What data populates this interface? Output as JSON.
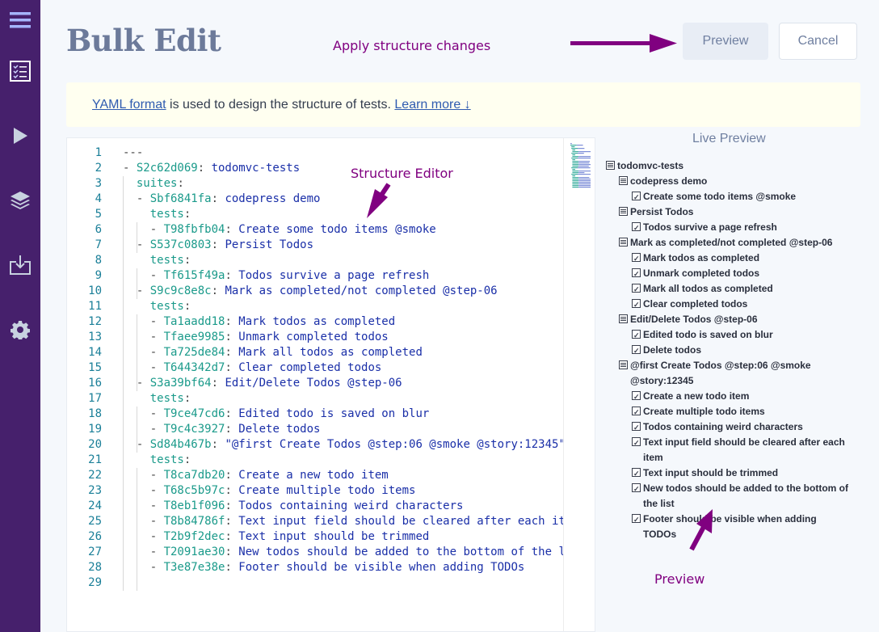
{
  "sidebar": {
    "items": [
      {
        "icon": "hamburger-menu-icon"
      },
      {
        "icon": "checklist-icon"
      },
      {
        "icon": "play-icon"
      },
      {
        "icon": "layers-icon"
      },
      {
        "icon": "download-icon"
      },
      {
        "icon": "gear-icon"
      }
    ]
  },
  "header": {
    "title": "Bulk Edit",
    "preview_label": "Preview",
    "cancel_label": "Cancel"
  },
  "annotations": {
    "apply": "Apply structure changes",
    "editor": "Structure Editor",
    "preview": "Preview",
    "color": "#800080"
  },
  "notice": {
    "link1": "YAML format",
    "text": " is used to design the structure of tests. ",
    "link2": "Learn more ↓"
  },
  "editor": {
    "lines": [
      {
        "n": "1",
        "indent": "",
        "dash": "",
        "key": "",
        "sep": "",
        "val": "---",
        "plain": true
      },
      {
        "n": "2",
        "indent": "",
        "dash": "- ",
        "key": "S2c62d069",
        "sep": ": ",
        "val": "todomvc-tests"
      },
      {
        "n": "3",
        "indent": "  ",
        "dash": "",
        "key": "suites",
        "sep": ":",
        "val": ""
      },
      {
        "n": "4",
        "indent": "  ",
        "dash": "- ",
        "key": "Sbf6841fa",
        "sep": ": ",
        "val": "codepress demo"
      },
      {
        "n": "5",
        "indent": "    ",
        "dash": "",
        "key": "tests",
        "sep": ":",
        "val": ""
      },
      {
        "n": "6",
        "indent": "    ",
        "dash": "- ",
        "key": "T98fbfb04",
        "sep": ": ",
        "val": "Create some todo items @smoke"
      },
      {
        "n": "7",
        "indent": "  ",
        "dash": "- ",
        "key": "S537c0803",
        "sep": ": ",
        "val": "Persist Todos"
      },
      {
        "n": "8",
        "indent": "    ",
        "dash": "",
        "key": "tests",
        "sep": ":",
        "val": ""
      },
      {
        "n": "9",
        "indent": "    ",
        "dash": "- ",
        "key": "Tf615f49a",
        "sep": ": ",
        "val": "Todos survive a page refresh"
      },
      {
        "n": "10",
        "indent": "  ",
        "dash": "- ",
        "key": "S9c9c8e8c",
        "sep": ": ",
        "val": "Mark as completed/not completed @step-06"
      },
      {
        "n": "11",
        "indent": "    ",
        "dash": "",
        "key": "tests",
        "sep": ":",
        "val": ""
      },
      {
        "n": "12",
        "indent": "    ",
        "dash": "- ",
        "key": "Ta1aadd18",
        "sep": ": ",
        "val": "Mark todos as completed"
      },
      {
        "n": "13",
        "indent": "    ",
        "dash": "- ",
        "key": "Tfaee9985",
        "sep": ": ",
        "val": "Unmark completed todos"
      },
      {
        "n": "14",
        "indent": "    ",
        "dash": "- ",
        "key": "Ta725de84",
        "sep": ": ",
        "val": "Mark all todos as completed"
      },
      {
        "n": "15",
        "indent": "    ",
        "dash": "- ",
        "key": "T644342d7",
        "sep": ": ",
        "val": "Clear completed todos"
      },
      {
        "n": "16",
        "indent": "  ",
        "dash": "- ",
        "key": "S3a39bf64",
        "sep": ": ",
        "val": "Edit/Delete Todos @step-06"
      },
      {
        "n": "17",
        "indent": "    ",
        "dash": "",
        "key": "tests",
        "sep": ":",
        "val": ""
      },
      {
        "n": "18",
        "indent": "    ",
        "dash": "- ",
        "key": "T9ce47cd6",
        "sep": ": ",
        "val": "Edited todo is saved on blur"
      },
      {
        "n": "19",
        "indent": "    ",
        "dash": "- ",
        "key": "T9c4c3927",
        "sep": ": ",
        "val": "Delete todos"
      },
      {
        "n": "20",
        "indent": "  ",
        "dash": "- ",
        "key": "Sd84b467b",
        "sep": ": ",
        "val": "\"@first Create Todos @step:06 @smoke @story:12345\""
      },
      {
        "n": "21",
        "indent": "    ",
        "dash": "",
        "key": "tests",
        "sep": ":",
        "val": ""
      },
      {
        "n": "22",
        "indent": "    ",
        "dash": "- ",
        "key": "T8ca7db20",
        "sep": ": ",
        "val": "Create a new todo item"
      },
      {
        "n": "23",
        "indent": "    ",
        "dash": "- ",
        "key": "T68c5b97c",
        "sep": ": ",
        "val": "Create multiple todo items"
      },
      {
        "n": "24",
        "indent": "    ",
        "dash": "- ",
        "key": "T8eb1f096",
        "sep": ": ",
        "val": "Todos containing weird characters"
      },
      {
        "n": "25",
        "indent": "    ",
        "dash": "- ",
        "key": "T8b84786f",
        "sep": ": ",
        "val": "Text input field should be cleared after each it"
      },
      {
        "n": "26",
        "indent": "    ",
        "dash": "- ",
        "key": "T2b9f2dec",
        "sep": ": ",
        "val": "Text input should be trimmed"
      },
      {
        "n": "27",
        "indent": "    ",
        "dash": "- ",
        "key": "T2091ae30",
        "sep": ": ",
        "val": "New todos should be added to the bottom of the l"
      },
      {
        "n": "28",
        "indent": "    ",
        "dash": "- ",
        "key": "T3e87e38e",
        "sep": ": ",
        "val": "Footer should be visible when adding TODOs"
      },
      {
        "n": "29",
        "indent": "",
        "dash": "",
        "key": "",
        "sep": "",
        "val": "",
        "plain": true
      }
    ]
  },
  "live_preview": {
    "title": "Live Preview",
    "root": "todomvc-tests",
    "suites": [
      {
        "name": "codepress demo",
        "tests": [
          "Create some todo items @smoke"
        ]
      },
      {
        "name": "Persist Todos",
        "tests": [
          "Todos survive a page refresh"
        ]
      },
      {
        "name": "Mark as completed/not completed @step-06",
        "tests": [
          "Mark todos as completed",
          "Unmark completed todos",
          "Mark all todos as completed",
          "Clear completed todos"
        ]
      },
      {
        "name": "Edit/Delete Todos @step-06",
        "tests": [
          "Edited todo is saved on blur",
          "Delete todos"
        ]
      },
      {
        "name": "@first Create Todos @step:06 @smoke @story:12345",
        "tests": [
          "Create a new todo item",
          "Create multiple todo items",
          "Todos containing weird characters",
          "Text input field should be cleared after each item",
          "Text input should be trimmed",
          "New todos should be added to the bottom of the list",
          "Footer should be visible when adding TODOs"
        ]
      }
    ]
  }
}
